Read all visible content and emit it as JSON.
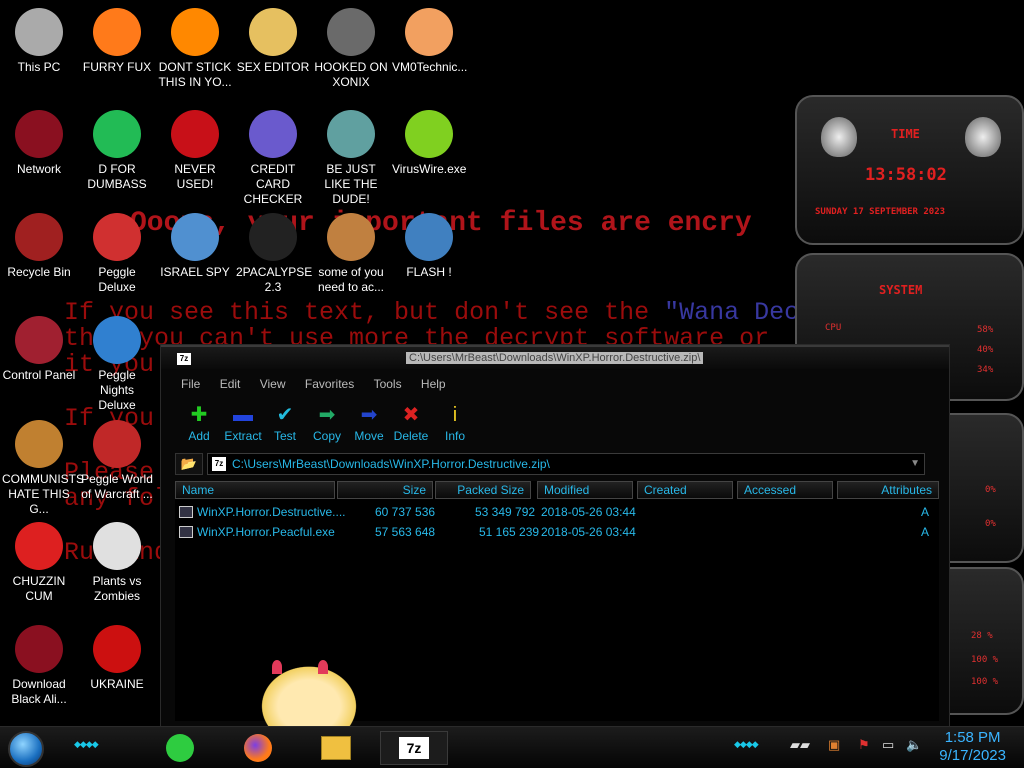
{
  "ransom": {
    "line1": "Ooops, your important files are encry",
    "line2a": "If you see this text, but don't see the ",
    "line2b": "\"Wana Decryp",
    "line3": "that you can't use more the decrypt software or",
    "line4": "it you",
    "line5": "If you",
    "line6": "Please",
    "line7": "any fol",
    "line8": "Run and"
  },
  "desktop_icons": [
    {
      "label": "This PC",
      "icon": "computer-icon"
    },
    {
      "label": "FURRY FUX",
      "icon": "firefox-icon"
    },
    {
      "label": "DONT STICK THIS IN YO...",
      "icon": "vlc-cone-icon"
    },
    {
      "label": "SEX EDITOR",
      "icon": "hxd-editor-icon"
    },
    {
      "label": "HOOKED ON XONIX",
      "icon": "xonix-game-icon"
    },
    {
      "label": "VM0Technic...",
      "icon": "doctor-person-icon"
    },
    {
      "label": "Network",
      "icon": "network-alien-icon"
    },
    {
      "label": "D FOR DUMBASS",
      "icon": "green-chat-icon"
    },
    {
      "label": "NEVER USED!",
      "icon": "dev-cpp-icon"
    },
    {
      "label": "CREDIT CARD CHECKER",
      "icon": "credit-card-icon"
    },
    {
      "label": "BE JUST LIKE THE DUDE!",
      "icon": "elf-character-icon"
    },
    {
      "label": "VirusWire.exe",
      "icon": "lime-icon"
    },
    {
      "label": "Recycle Bin",
      "icon": "recycle-bin-icon"
    },
    {
      "label": "Peggle Deluxe",
      "icon": "peggle-icon"
    },
    {
      "label": "ISRAEL SPY",
      "icon": "spy-computer-icon"
    },
    {
      "label": "2PACALYPSE 2.3",
      "icon": "terminal-icon"
    },
    {
      "label": "some of you need to ac...",
      "icon": "dog-icon"
    },
    {
      "label": "FLASH !",
      "icon": "flash-icon"
    },
    {
      "label": "Control Panel",
      "icon": "control-panel-icon"
    },
    {
      "label": "Peggle Nights Deluxe",
      "icon": "peggle-nights-icon"
    },
    {
      "label": "COMMUNISTS HATE THIS G...",
      "icon": "money-bag-icon"
    },
    {
      "label": "Peggle World of Warcraft ...",
      "icon": "peggle-wow-icon"
    },
    {
      "label": "CHUZZIN CUM",
      "icon": "chuzzle-icon"
    },
    {
      "label": "Plants vs Zombies",
      "icon": "pvz-flower-icon"
    },
    {
      "label": "Download Black Ali...",
      "icon": "alien-download-icon"
    },
    {
      "label": "UKRAINE",
      "icon": "radiation-icon"
    }
  ],
  "gadget": {
    "time_label": "TIME",
    "time": "13:58:02",
    "date": "SUNDAY 17 SEPTEMBER 2023",
    "system_label": "SYSTEM",
    "cpu_label": "CPU",
    "cpu_vals": [
      "58%",
      "40%",
      "34%"
    ],
    "mid_vals": [
      "0%",
      "0%"
    ],
    "low_vals": [
      "28 %",
      "100 %",
      "100 %"
    ]
  },
  "window": {
    "title": "C:\\Users\\MrBeast\\Downloads\\WinXP.Horror.Destructive.zip\\",
    "app_icon": "7z",
    "menu": [
      "File",
      "Edit",
      "View",
      "Favorites",
      "Tools",
      "Help"
    ],
    "toolbar": [
      {
        "label": "Add",
        "icon": "plus-icon",
        "glyph": "✚",
        "color": "#22cc22"
      },
      {
        "label": "Extract",
        "icon": "minus-icon",
        "glyph": "▬",
        "color": "#2244dd"
      },
      {
        "label": "Test",
        "icon": "check-icon",
        "glyph": "✔",
        "color": "#22bbdd"
      },
      {
        "label": "Copy",
        "icon": "copy-arrow-icon",
        "glyph": "➡",
        "color": "#22aa66"
      },
      {
        "label": "Move",
        "icon": "move-arrow-icon",
        "glyph": "➡",
        "color": "#2244cc"
      },
      {
        "label": "Delete",
        "icon": "delete-x-icon",
        "glyph": "✖",
        "color": "#dd2222"
      },
      {
        "label": "Info",
        "icon": "info-icon",
        "glyph": "i",
        "color": "#eecc22"
      }
    ],
    "address": "C:\\Users\\MrBeast\\Downloads\\WinXP.Horror.Destructive.zip\\",
    "columns": [
      "Name",
      "Size",
      "Packed Size",
      "Modified",
      "Created",
      "Accessed",
      "Attributes"
    ],
    "files": [
      {
        "name": "WinXP.Horror.Destructive....",
        "size": "60 737 536",
        "packed": "53 349 792",
        "modified": "2018-05-26 03:44",
        "attr": "A"
      },
      {
        "name": "WinXP.Horror.Peacful.exe",
        "size": "57 563 648",
        "packed": "51 165 239",
        "modified": "2018-05-26 03:44",
        "attr": "A"
      }
    ]
  },
  "taskbar": {
    "apps": [
      "green-chat-icon",
      "firefox-icon",
      "file-explorer-icon",
      "7zip-icon"
    ],
    "seven_zip_label": "7z",
    "time": "1:58 PM",
    "date": "9/17/2023"
  },
  "colors": {
    "accent_cyan": "#28b8e8",
    "ransom_red": "#b0141a",
    "gadget_red": "#e02020",
    "clock_blue": "#3ab4ff"
  }
}
